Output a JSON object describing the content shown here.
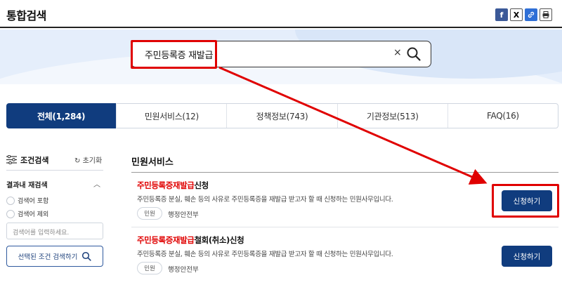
{
  "header": {
    "title": "통합검색",
    "share": [
      {
        "icon": "facebook-icon",
        "glyph": "f"
      },
      {
        "icon": "x-icon",
        "glyph": "X"
      },
      {
        "icon": "link-icon",
        "glyph": "🔗"
      },
      {
        "icon": "print-icon",
        "glyph": "⎙"
      }
    ]
  },
  "search": {
    "query": "주민등록증 재발급",
    "clear_glyph": "×"
  },
  "tabs": [
    {
      "label": "전체(1,284)",
      "active": true
    },
    {
      "label": "민원서비스(12)",
      "active": false
    },
    {
      "label": "정책정보(743)",
      "active": false
    },
    {
      "label": "기관정보(513)",
      "active": false
    },
    {
      "label": "FAQ(16)",
      "active": false
    }
  ],
  "sidebar": {
    "title": "조건검색",
    "reset_label": "초기화",
    "section_title": "결과내 재검색",
    "options": [
      "검색어 포함",
      "검색어 제외"
    ],
    "input_placeholder": "검색어를 입력하세요.",
    "search_button": "선택된 조건 검색하기"
  },
  "main": {
    "section_title": "민원서비스",
    "results": [
      {
        "title_highlight": "주민등록증재발급",
        "title_rest": "신청",
        "description": "주민등록증 분실, 훼손 등의 사유로 주민등록증을 재발급 받고자 할 때 신청하는 민원사무입니다.",
        "tag": "민원",
        "org": "행정안전부",
        "button": "신청하기"
      },
      {
        "title_highlight": "주민등록증재발급",
        "title_rest": "철회(취소)신청",
        "description": "주민등록증 분실, 훼손 등의 사유로 주민등록증을 재발급 받고자 할 때 신청하는 민원사무입니다.",
        "tag": "민원",
        "org": "행정안전부",
        "button": "신청하기"
      }
    ]
  },
  "colors": {
    "primary": "#103c7e",
    "highlight": "#e00000",
    "band": "#e5eefb"
  }
}
